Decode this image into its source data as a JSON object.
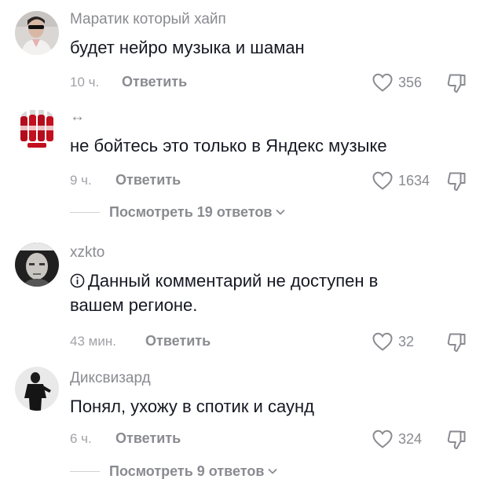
{
  "colors": {
    "text_primary": "#161823",
    "text_secondary": "#8a8b91",
    "text_timestamp": "#a1a2a7",
    "divider": "#d0d1d4"
  },
  "comments": [
    {
      "author": "Маратик который хайп",
      "text": "будет нейро музыка и шаман",
      "time": "10 ч.",
      "reply_label": "Ответить",
      "likes": "356",
      "avatar": "person-sunglasses-avatar"
    },
    {
      "author": "↔",
      "text": "не бойтесь это только в Яндекс музыке",
      "time": "9 ч.",
      "reply_label": "Ответить",
      "likes": "1634",
      "avatar": "soda-bottles-avatar",
      "view_replies": "Посмотреть 19 ответов"
    },
    {
      "author": "xzkto",
      "info_icon": "info-circle-icon",
      "text": "Данный комментарий не доступен в вашем регионе.",
      "time": "43 мин.",
      "reply_label": "Ответить",
      "likes": "32",
      "avatar": "bald-man-avatar"
    },
    {
      "author": "Диксвизард",
      "text": "Понял, ухожу в спотик и саунд",
      "time": "6 ч.",
      "reply_label": "Ответить",
      "likes": "324",
      "avatar": "dark-figure-avatar",
      "view_replies": "Посмотреть 9 ответов"
    }
  ]
}
